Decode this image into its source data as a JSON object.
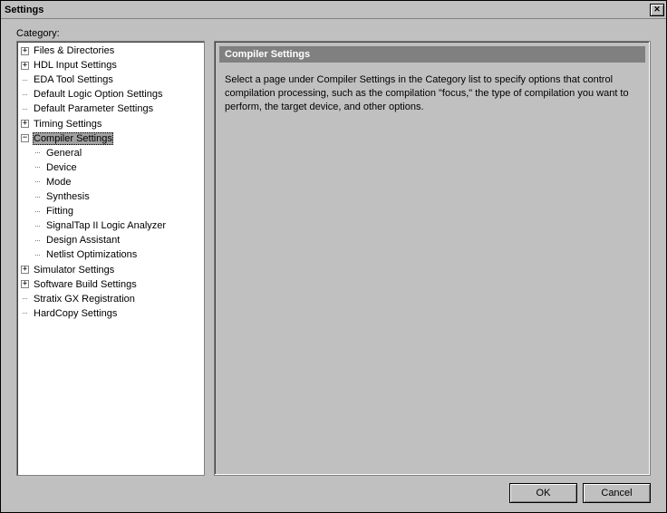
{
  "window": {
    "title": "Settings"
  },
  "labels": {
    "category": "Category:"
  },
  "tree": {
    "files_and_directories": "Files & Directories",
    "hdl_input_settings": "HDL Input Settings",
    "eda_tool_settings": "EDA Tool Settings",
    "default_logic_option_settings": "Default Logic Option Settings",
    "default_parameter_settings": "Default Parameter Settings",
    "timing_settings": "Timing Settings",
    "compiler_settings": "Compiler Settings",
    "compiler_children": {
      "general": "General",
      "device": "Device",
      "mode": "Mode",
      "synthesis": "Synthesis",
      "fitting": "Fitting",
      "signaltap": "SignalTap II Logic Analyzer",
      "design_assistant": "Design Assistant",
      "netlist_optimizations": "Netlist Optimizations"
    },
    "simulator_settings": "Simulator Settings",
    "software_build_settings": "Software Build Settings",
    "stratix_gx_registration": "Stratix GX Registration",
    "hardcopy_settings": "HardCopy Settings"
  },
  "panel": {
    "title": "Compiler Settings",
    "body": "Select a page under Compiler Settings in the Category list to specify options that control compilation processing, such as the compilation \"focus,\" the type of compilation you want to perform, the target device, and other options."
  },
  "buttons": {
    "ok": "OK",
    "cancel": "Cancel"
  },
  "glyphs": {
    "plus": "+",
    "minus": "−",
    "close": "✕"
  }
}
